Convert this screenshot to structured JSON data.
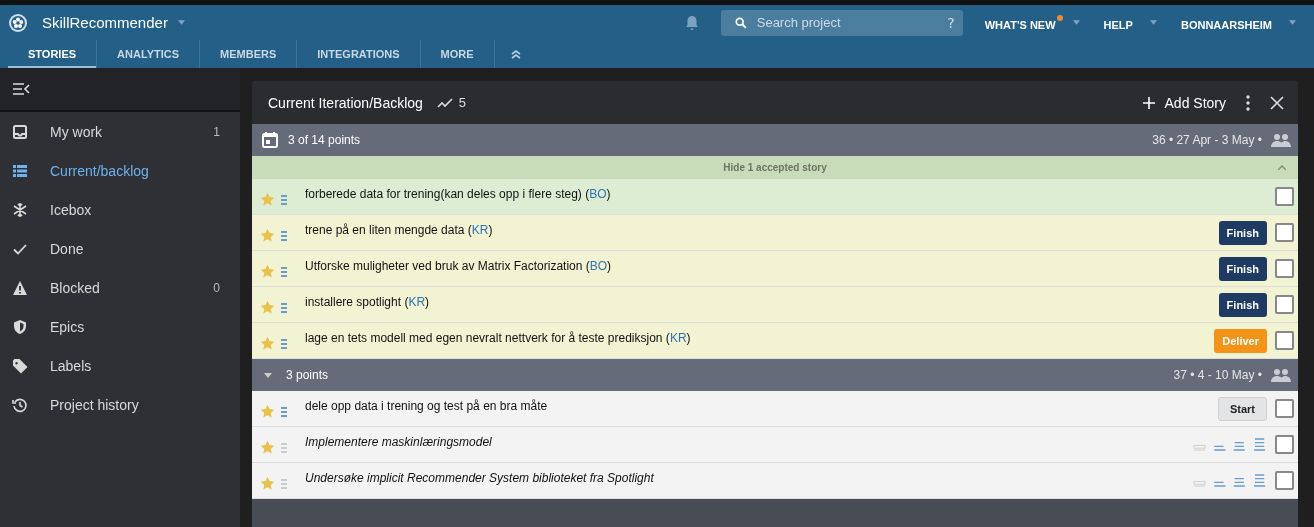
{
  "project": {
    "name": "SkillRecommender"
  },
  "tabs": [
    {
      "label": "STORIES",
      "selected": true
    },
    {
      "label": "ANALYTICS",
      "selected": false
    },
    {
      "label": "MEMBERS",
      "selected": false
    },
    {
      "label": "INTEGRATIONS",
      "selected": false
    },
    {
      "label": "MORE",
      "selected": false
    }
  ],
  "search": {
    "placeholder": "Search project",
    "help": "?"
  },
  "top_links": [
    {
      "label": "WHAT'S NEW",
      "badge": true
    },
    {
      "label": "HELP",
      "badge": false
    },
    {
      "label": "BONNAARSHEIM",
      "badge": false
    }
  ],
  "sidebar": {
    "items": [
      {
        "kind": "inbox",
        "label": "My work",
        "count": "1",
        "selected": false
      },
      {
        "kind": "list",
        "label": "Current/backlog",
        "selected": true
      },
      {
        "kind": "snow",
        "label": "Icebox",
        "selected": false
      },
      {
        "kind": "check",
        "label": "Done",
        "selected": false
      },
      {
        "kind": "warning",
        "label": "Blocked",
        "count": "0",
        "selected": false
      },
      {
        "kind": "shield",
        "label": "Epics",
        "selected": false
      },
      {
        "kind": "tag",
        "label": "Labels",
        "selected": false
      },
      {
        "kind": "history",
        "label": "Project history",
        "selected": false
      }
    ]
  },
  "panel": {
    "title": "Current Iteration/Backlog",
    "velocity": "5",
    "add_label": "Add Story",
    "iterations": [
      {
        "kind": "current",
        "points": "3 of 14 points",
        "dates": "36 • 27 Apr - 3 May •",
        "hide_label": "Hide 1 accepted story",
        "stories": [
          {
            "kind": "accepted",
            "text": "forberede data for trening(kan deles opp i flere steg) (",
            "owner": "BO",
            "close": ")",
            "checked": false
          },
          {
            "kind": "started",
            "text": "trene på en liten mengde data (",
            "owner": "KR",
            "close": ")",
            "action": {
              "label": "Finish",
              "kind": "finish"
            },
            "checked": false
          },
          {
            "kind": "started",
            "text": "Utforske muligheter ved bruk av Matrix Factorization  (",
            "owner": "BO",
            "close": ")",
            "action": {
              "label": "Finish",
              "kind": "finish"
            },
            "checked": false
          },
          {
            "kind": "started",
            "text": "installere spotlight (",
            "owner": "KR",
            "close": ")",
            "action": {
              "label": "Finish",
              "kind": "finish"
            },
            "checked": false
          },
          {
            "kind": "finished",
            "text": "lage en tets modell med egen nevralt nettverk for å teste prediksjon (",
            "owner": "KR",
            "close": ")",
            "action": {
              "label": "Deliver",
              "kind": "deliver"
            },
            "checked": false
          }
        ]
      },
      {
        "kind": "backlog",
        "points": "3 points",
        "dates": "37 • 4 - 10 May •",
        "stories": [
          {
            "kind": "unstarted",
            "text": "dele opp data i trening og test på en bra måte",
            "action": {
              "label": "Start",
              "kind": "start"
            },
            "checked": false
          },
          {
            "kind": "unestimated",
            "text": "Implementere maskinlæringsmodel",
            "checked": false
          },
          {
            "kind": "unestimated",
            "text": "Undersøke implicit Recommender System biblioteket fra Spotlight",
            "checked": false
          }
        ]
      }
    ]
  }
}
